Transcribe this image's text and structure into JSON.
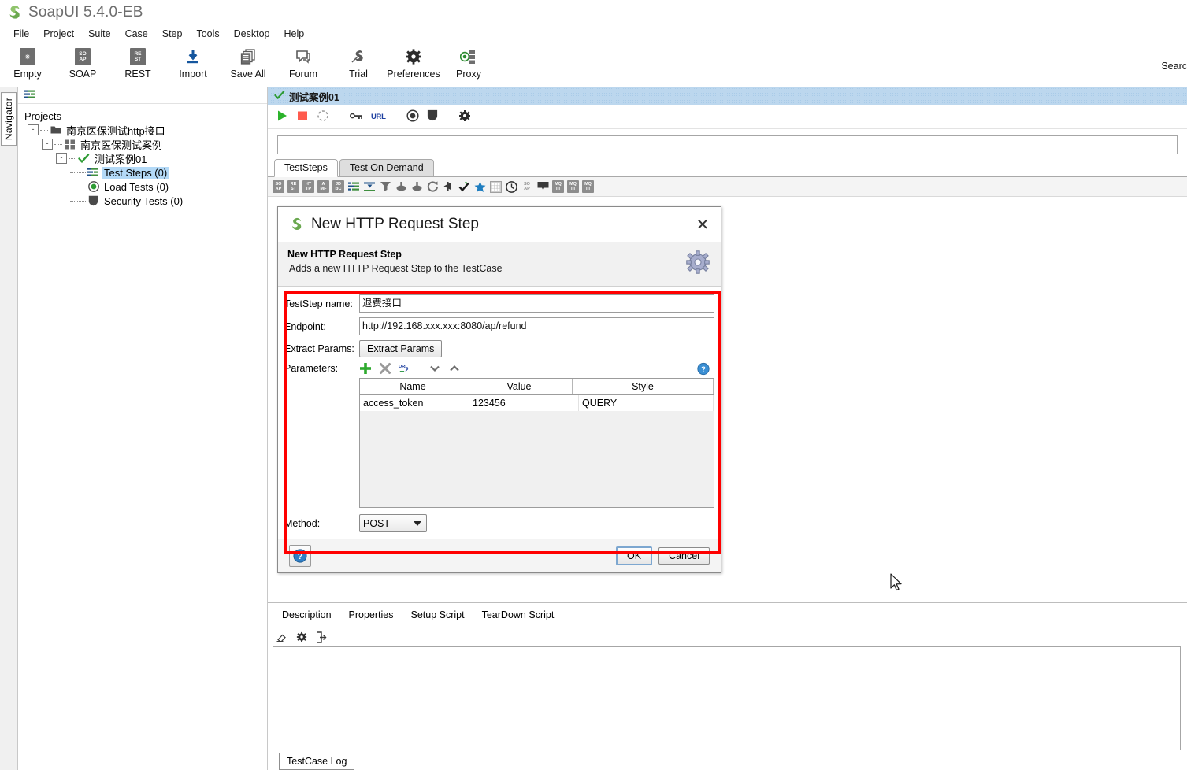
{
  "window": {
    "title": "SoapUI 5.4.0-EB",
    "logo_icon": "soapui-logo-icon"
  },
  "menubar": {
    "items": [
      {
        "label": "File"
      },
      {
        "label": "Project"
      },
      {
        "label": "Suite"
      },
      {
        "label": "Case"
      },
      {
        "label": "Step"
      },
      {
        "label": "Tools"
      },
      {
        "label": "Desktop"
      },
      {
        "label": "Help"
      }
    ]
  },
  "toolbar": {
    "buttons": [
      {
        "label": "Empty",
        "icon": "empty-project-icon",
        "glyph": ""
      },
      {
        "label": "SOAP",
        "icon": "soap-project-icon",
        "glyph": "SO|AP"
      },
      {
        "label": "REST",
        "icon": "rest-project-icon",
        "glyph": "RE|ST"
      },
      {
        "label": "Import",
        "icon": "import-icon",
        "glyph": ""
      },
      {
        "label": "Save All",
        "icon": "save-all-icon",
        "glyph": ""
      },
      {
        "label": "Forum",
        "icon": "forum-icon",
        "glyph": ""
      },
      {
        "label": "Trial",
        "icon": "trial-icon",
        "glyph": ""
      },
      {
        "label": "Preferences",
        "icon": "gear-icon",
        "glyph": ""
      },
      {
        "label": "Proxy",
        "icon": "proxy-icon",
        "glyph": ""
      }
    ],
    "search_label": "Searc"
  },
  "navigator": {
    "tab_label": "Navigator",
    "root_label": "Projects",
    "tree": [
      {
        "label": "南京医保测试http接口",
        "icon": "project-folder-icon",
        "indent": 0,
        "twisty": "-",
        "selected": false
      },
      {
        "label": "南京医保测试案例",
        "icon": "testsuite-icon",
        "indent": 1,
        "twisty": "-",
        "selected": false
      },
      {
        "label": "测试案例01",
        "icon": "testcase-check-icon",
        "indent": 2,
        "twisty": "-",
        "selected": false
      },
      {
        "label": "Test Steps (0)",
        "icon": "teststeps-icon",
        "indent": 3,
        "twisty": "",
        "selected": true
      },
      {
        "label": "Load Tests (0)",
        "icon": "loadtests-icon",
        "indent": 3,
        "twisty": "",
        "selected": false
      },
      {
        "label": "Security Tests (0)",
        "icon": "securitytests-icon",
        "indent": 3,
        "twisty": "",
        "selected": false
      }
    ]
  },
  "editor": {
    "case_title": "测试案例01",
    "run_toolbar": [
      {
        "icon": "run-icon"
      },
      {
        "icon": "stop-icon"
      },
      {
        "icon": "loop-icon"
      },
      {
        "icon": "properties-icon"
      },
      {
        "icon": "url-icon"
      },
      {
        "icon": "loadtest-icon"
      },
      {
        "icon": "securitytest-icon"
      },
      {
        "icon": "options-gear-icon"
      }
    ],
    "tabs": [
      {
        "label": "TestSteps",
        "active": true
      },
      {
        "label": "Test On Demand",
        "active": false
      }
    ],
    "steps_toolbar": [
      {
        "icon": "add-soap-request-icon",
        "glyph": "SO|AP"
      },
      {
        "icon": "add-rest-request-icon",
        "glyph": "RE|ST"
      },
      {
        "icon": "add-http-request-icon",
        "glyph": "HT|TP"
      },
      {
        "icon": "add-amf-request-icon",
        "glyph": "A|MF"
      },
      {
        "icon": "add-jdbc-request-icon",
        "glyph": "JD|BC"
      },
      {
        "icon": "add-properties-icon",
        "glyph": ""
      },
      {
        "icon": "add-property-transfer-icon",
        "glyph": ""
      },
      {
        "icon": "add-conditional-goto-icon",
        "glyph": ""
      },
      {
        "icon": "add-groovy-script-icon",
        "glyph": ""
      },
      {
        "icon": "add-groovy-script-2-icon",
        "glyph": ""
      },
      {
        "icon": "add-delay-icon",
        "glyph": ""
      },
      {
        "icon": "add-datasource-icon",
        "glyph": ""
      },
      {
        "icon": "add-assertion-icon",
        "glyph": ""
      },
      {
        "icon": "add-datagen-icon",
        "glyph": ""
      },
      {
        "icon": "add-datasink-icon",
        "glyph": ""
      },
      {
        "icon": "add-wait-icon",
        "glyph": ""
      },
      {
        "icon": "add-mock-response-icon",
        "glyph": "SO|AP"
      },
      {
        "icon": "add-manual-teststep-icon",
        "glyph": ""
      },
      {
        "icon": "add-mqtt-publish-icon",
        "glyph": "MQ|TT"
      },
      {
        "icon": "add-mqtt-receive-icon",
        "glyph": "MQ|TT"
      },
      {
        "icon": "add-mqtt-drop-icon",
        "glyph": "MQ|TT"
      }
    ],
    "sub_tabs": [
      {
        "label": "Description"
      },
      {
        "label": "Properties"
      },
      {
        "label": "Setup Script"
      },
      {
        "label": "TearDown Script"
      }
    ],
    "log_toolbar": [
      {
        "icon": "clear-log-icon"
      },
      {
        "icon": "log-settings-gear-icon"
      },
      {
        "icon": "export-log-icon"
      }
    ],
    "bottom_tabs": [
      {
        "label": "TestCase Log",
        "active": true
      }
    ]
  },
  "dialog": {
    "title": "New HTTP Request Step",
    "logo_icon": "soapui-logo-icon",
    "close_icon": "close-icon",
    "header_title": "New HTTP Request Step",
    "header_subtitle": "Adds a new HTTP Request Step to the TestCase",
    "header_icon": "gear-icon",
    "fields": {
      "teststep_name_label": "TestStep name:",
      "teststep_name_value": "退费接口",
      "endpoint_label": "Endpoint:",
      "endpoint_value": "http://192.168.xxx.xxx:8080/ap/refund",
      "extract_params_label": "Extract Params:",
      "extract_params_button": "Extract Params",
      "parameters_label": "Parameters:",
      "method_label": "Method:",
      "method_value": "POST"
    },
    "params_toolbar": [
      {
        "icon": "add-param-icon"
      },
      {
        "icon": "delete-param-icon"
      },
      {
        "icon": "url-param-icon"
      },
      {
        "icon": "move-down-icon"
      },
      {
        "icon": "move-up-icon"
      },
      {
        "icon": "help-icon"
      }
    ],
    "params_table": {
      "columns": [
        "Name",
        "Value",
        "Style"
      ],
      "rows": [
        {
          "name": "access_token",
          "value": "123456",
          "style": "QUERY"
        }
      ]
    },
    "footer": {
      "help_icon": "help-icon",
      "ok_label": "OK",
      "cancel_label": "Cancel"
    }
  },
  "annotation": {
    "highlight_color": "#ff0000"
  },
  "cursor": {
    "icon": "mouse-pointer-icon"
  }
}
